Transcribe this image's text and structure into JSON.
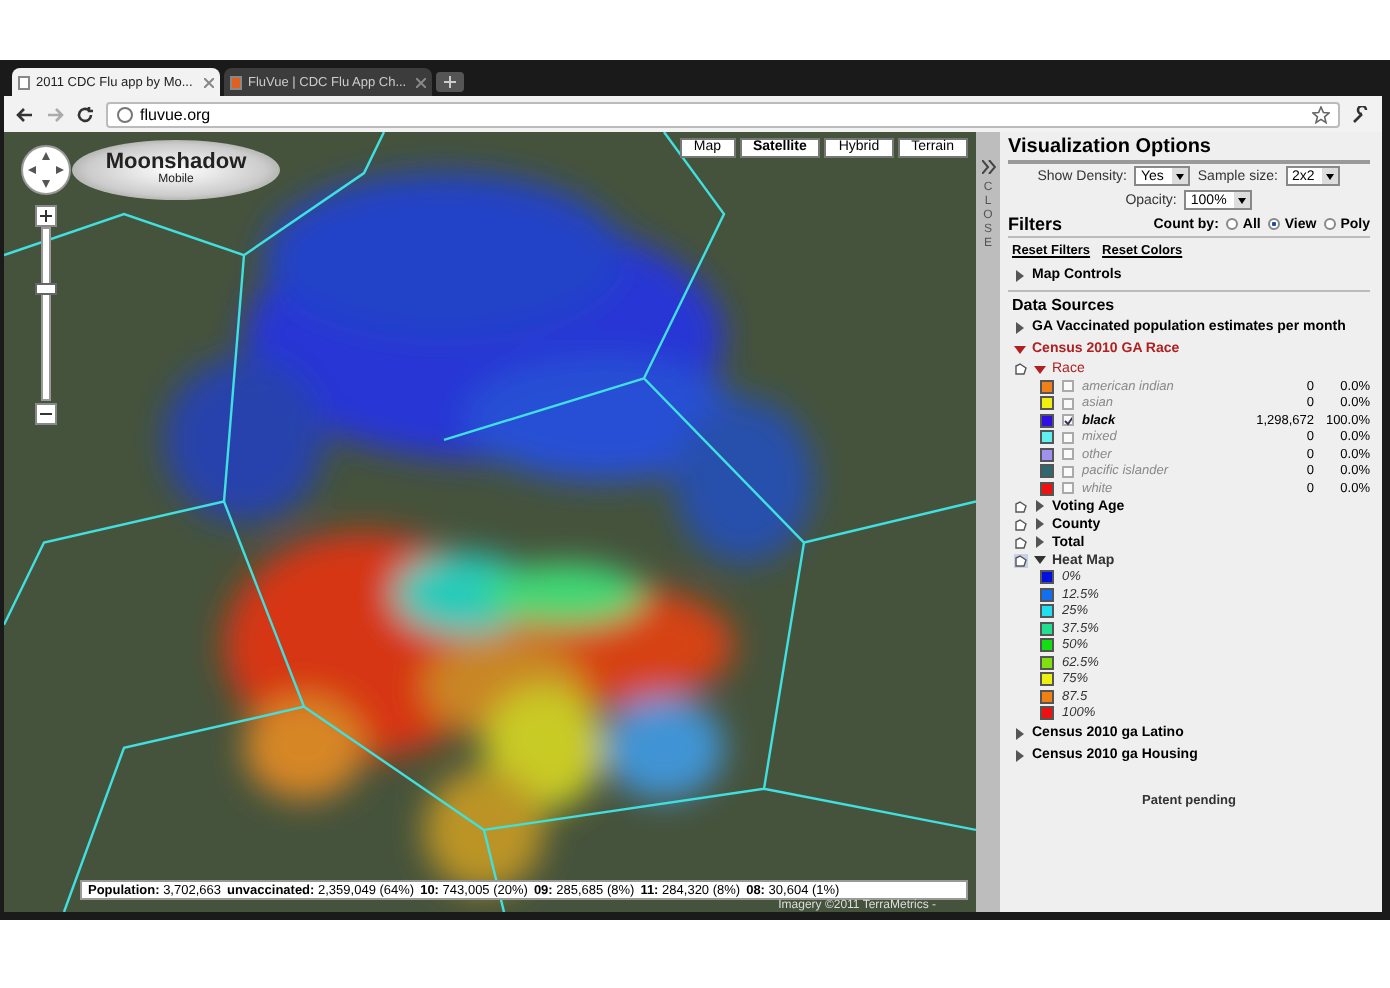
{
  "browser": {
    "tabs": [
      {
        "title": "2011 CDC Flu app by Mo...",
        "selected": true
      },
      {
        "title": "FluVue | CDC Flu App Ch...",
        "selected": false
      }
    ],
    "url": "fluvue.org"
  },
  "map": {
    "logo": {
      "name": "Moonshadow",
      "sub": "Mobile"
    },
    "map_types": [
      {
        "label": "Map",
        "selected": false
      },
      {
        "label": "Satellite",
        "selected": true
      },
      {
        "label": "Hybrid",
        "selected": false
      },
      {
        "label": "Terrain",
        "selected": false
      }
    ],
    "stats": [
      {
        "label": "Population:",
        "value": "3,702,663"
      },
      {
        "label": "unvaccinated:",
        "value": "2,359,049 (64%)"
      },
      {
        "label": "10:",
        "value": "743,005 (20%)"
      },
      {
        "label": "09:",
        "value": "285,685 (8%)"
      },
      {
        "label": "11:",
        "value": "284,320 (8%)"
      },
      {
        "label": "08:",
        "value": "30,604 (1%)"
      }
    ],
    "attribution": "Imagery ©2011 TerraMetrics -"
  },
  "panel": {
    "close_label": "CLOSE",
    "title": "Visualization Options",
    "options": [
      {
        "label": "Show Density:",
        "value": "Yes"
      },
      {
        "label": "Sample size:",
        "value": "2x2"
      },
      {
        "label": "Opacity:",
        "value": "100%"
      }
    ],
    "filters": {
      "title": "Filters",
      "count_by": "Count by:",
      "choices": [
        {
          "label": "All",
          "selected": false
        },
        {
          "label": "View",
          "selected": true
        },
        {
          "label": "Poly",
          "selected": false
        }
      ],
      "links": [
        "Reset Filters",
        "Reset Colors"
      ]
    },
    "map_controls": {
      "label": "Map Controls",
      "expanded": false
    },
    "data_sources_title": "Data Sources",
    "sources": [
      {
        "label": "GA Vaccinated population estimates per month",
        "expanded": false
      },
      {
        "label": "Census 2010 GA Race",
        "expanded": true,
        "groups": [
          {
            "label": "Race",
            "kind": "category",
            "expanded": true,
            "items": [
              {
                "label": "american indian",
                "color": "#f08018",
                "checked": false,
                "count": "0",
                "percent": "0.0%"
              },
              {
                "label": "asian",
                "color": "#f0f010",
                "checked": false,
                "count": "0",
                "percent": "0.0%"
              },
              {
                "label": "black",
                "color": "#3010e0",
                "checked": true,
                "count": "1,298,672",
                "percent": "100.0%"
              },
              {
                "label": "mixed",
                "color": "#60f0f0",
                "checked": false,
                "count": "0",
                "percent": "0.0%"
              },
              {
                "label": "other",
                "color": "#a090f0",
                "checked": false,
                "count": "0",
                "percent": "0.0%"
              },
              {
                "label": "pacific islander",
                "color": "#306870",
                "checked": false,
                "count": "0",
                "percent": "0.0%"
              },
              {
                "label": "white",
                "color": "#f01010",
                "checked": false,
                "count": "0",
                "percent": "0.0%"
              }
            ]
          },
          {
            "label": "Voting Age",
            "kind": "category",
            "expanded": false
          },
          {
            "label": "County",
            "kind": "category",
            "expanded": false
          },
          {
            "label": "Total",
            "kind": "category",
            "expanded": false
          },
          {
            "label": "Heat Map",
            "kind": "legend",
            "expanded": true,
            "items": [
              {
                "label": "0%",
                "color": "#0010e0"
              },
              {
                "label": "12.5%",
                "color": "#1070f0"
              },
              {
                "label": "25%",
                "color": "#20e0f0"
              },
              {
                "label": "37.5%",
                "color": "#20e090"
              },
              {
                "label": "50%",
                "color": "#10e010"
              },
              {
                "label": "62.5%",
                "color": "#80e010"
              },
              {
                "label": "75%",
                "color": "#f0f010"
              },
              {
                "label": "87.5",
                "color": "#f08010"
              },
              {
                "label": "100%",
                "color": "#f01010"
              }
            ]
          }
        ]
      },
      {
        "label": "Census 2010 ga Latino",
        "expanded": false
      },
      {
        "label": "Census 2010 ga Housing",
        "expanded": false
      }
    ],
    "footer": "Patent pending"
  }
}
